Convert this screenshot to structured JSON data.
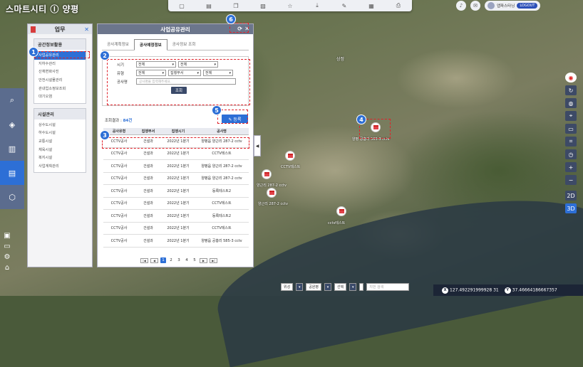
{
  "app": {
    "title": "스마트시티 Ⓘ 양평"
  },
  "toolbar": {
    "icons": [
      "document-icon",
      "file-icon",
      "copy-icon",
      "image-icon",
      "star-icon",
      "download-icon",
      "edit-icon",
      "book-icon",
      "print-icon"
    ]
  },
  "user": {
    "name": "앱파스타닝",
    "logout_label": "LOGOUT"
  },
  "leftbar": {
    "items": [
      "search-icon",
      "layers-icon",
      "map-icon",
      "document-icon",
      "cube-icon"
    ],
    "bottom": [
      "clipboard-icon",
      "monitor-icon",
      "settings-icon",
      "plugin-icon"
    ]
  },
  "panel1": {
    "title": "업무",
    "section1": {
      "title": "공간정보활용",
      "items": [
        "사업공유관리",
        "지하수관리",
        "산재변화사진",
        "안전시설물관리",
        "관내업소정보조회",
        "대기오염"
      ]
    },
    "section2": {
      "title": "시설관리",
      "items": [
        "상수도시설",
        "하수도시설",
        "교통시설",
        "체육시설",
        "복지시설",
        "사업계획관리"
      ]
    }
  },
  "panel2": {
    "title": "사업공유관리",
    "tabs": [
      "공사계획정보",
      "공사예정정보",
      "공사정보 조회"
    ],
    "active_tab": 1,
    "filters": {
      "period_label": "시기",
      "period_value1": "전체",
      "period_value2": "전체",
      "type_label": "유형",
      "type_value1": "전체",
      "type_value2": "집행부서",
      "type_value3": "전체",
      "name_label": "공사명",
      "name_placeholder": "공사명을 입력해주세요.",
      "search_label": "조회"
    },
    "result_prefix": "조회결과 : ",
    "result_count": "84건",
    "register_label": "✎ 등록",
    "table": {
      "headers": [
        "공사유형",
        "집행부서",
        "집행시기",
        "공사명"
      ],
      "rows": [
        [
          "CCTV공사",
          "건설과",
          "2022년 1분기",
          "양평읍 양근리 287-2 cctv"
        ],
        [
          "CCTV공사",
          "건설과",
          "2022년 1분기",
          "CCTV테스트"
        ],
        [
          "CCTV공사",
          "건설과",
          "2022년 1분기",
          "양평읍 양근리 287-2 cctv"
        ],
        [
          "CCTV공사",
          "건설과",
          "2022년 1분기",
          "양평읍 양근리 287-2 cctv"
        ],
        [
          "CCTV공사",
          "건설과",
          "2022년 1분기",
          "등록테스트2"
        ],
        [
          "CCTV공사",
          "건설과",
          "2022년 1분기",
          "CCTV테스트"
        ],
        [
          "CCTV공사",
          "건설과",
          "2022년 1분기",
          "등록테스트2"
        ],
        [
          "CCTV공사",
          "건설과",
          "2022년 1분기",
          "CCTV테스트"
        ],
        [
          "CCTV공사",
          "건설과",
          "2022년 1분기",
          "양평읍 공흥리 585-3 cctv"
        ]
      ]
    },
    "pager": {
      "first": "|◀",
      "prev": "◀",
      "pages": [
        "1",
        "2",
        "3",
        "4",
        "5"
      ],
      "current": "1",
      "next": "▶",
      "last": "▶|"
    }
  },
  "badges": [
    "1",
    "2",
    "3",
    "4",
    "5",
    "6"
  ],
  "map": {
    "labels": [
      "상정",
      "양평 공흥리 585-3 cctv",
      "CCTV테스트",
      "양근리 287-2 cctv",
      "양근리 287-2 cctv",
      "cctv테스트"
    ],
    "marker_icon": "calendar-icon"
  },
  "rightbar": {
    "items": [
      "compass-icon",
      "refresh-icon",
      "globe-icon",
      "measure-icon",
      "ruler-icon",
      "area-icon",
      "clock-icon",
      "zoom-in-icon",
      "zoom-out-icon"
    ],
    "mode_2d": "2D",
    "mode_3d": "3D"
  },
  "bottombar": {
    "select1": "위성",
    "select2": "공원병",
    "select3": "선택",
    "search_placeholder": "지번 검색"
  },
  "coords": {
    "x_label": "X",
    "x_value": "127.492291999928 31",
    "y_label": "Y",
    "y_value": "37.46664186667357"
  },
  "colors": {
    "accent": "#2d6fd6",
    "highlight": "#e0222a",
    "header": "#6c768c"
  }
}
